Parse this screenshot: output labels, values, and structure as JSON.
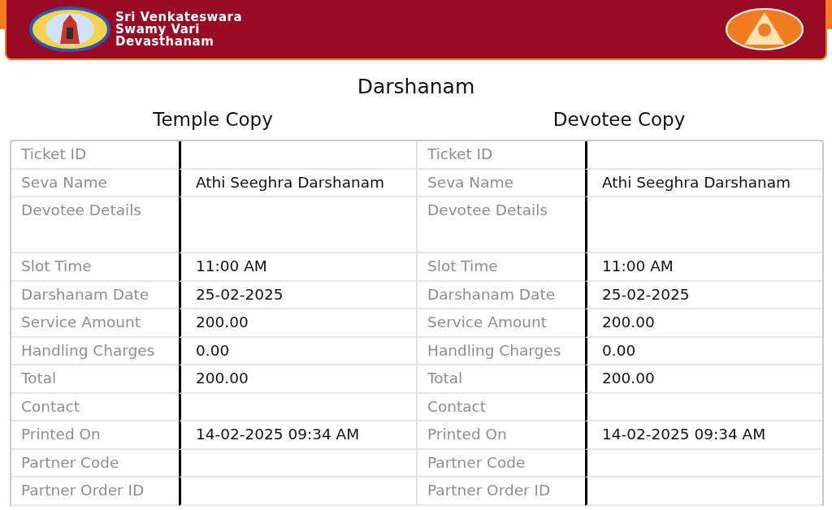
{
  "header": {
    "name_lines": [
      "Sri Venkateswara",
      "Swamy Vari",
      "Devasthanam"
    ]
  },
  "title": "Darshanam",
  "copies": [
    {
      "heading": "Temple Copy",
      "rows": [
        {
          "kind": "line",
          "label": "Ticket ID"
        },
        {
          "kind": "line",
          "label": "Seva Name",
          "value": "Athi Seeghra Darshanam"
        },
        {
          "kind": "tall",
          "label": "Devotee Details"
        },
        {
          "kind": "line",
          "label": "Slot Time",
          "value": "11:00 AM"
        },
        {
          "kind": "line",
          "label": "Darshanam Date",
          "value": "25-02-2025"
        },
        {
          "kind": "line",
          "label": "Service Amount",
          "value": "200.00"
        },
        {
          "kind": "line",
          "label": "Handling Charges",
          "value": "0.00"
        },
        {
          "kind": "line",
          "label": "Total",
          "value": "200.00"
        },
        {
          "kind": "line",
          "label": "Contact"
        },
        {
          "kind": "line",
          "label": "Printed On",
          "value": "14-02-2025 09:34 AM"
        },
        {
          "kind": "line",
          "label": "Partner Code"
        },
        {
          "kind": "line",
          "label": "Partner Order ID"
        }
      ]
    },
    {
      "heading": "Devotee Copy",
      "rows": [
        {
          "kind": "line",
          "label": "Ticket ID"
        },
        {
          "kind": "line",
          "label": "Seva Name",
          "value": "Athi Seeghra Darshanam"
        },
        {
          "kind": "tall",
          "label": "Devotee Details"
        },
        {
          "kind": "line",
          "label": "Slot Time",
          "value": "11:00 AM"
        },
        {
          "kind": "line",
          "label": "Darshanam Date",
          "value": "25-02-2025"
        },
        {
          "kind": "line",
          "label": "Service Amount",
          "value": "200.00"
        },
        {
          "kind": "line",
          "label": "Handling Charges",
          "value": "0.00"
        },
        {
          "kind": "line",
          "label": "Total",
          "value": "200.00"
        },
        {
          "kind": "line",
          "label": "Contact"
        },
        {
          "kind": "line",
          "label": "Printed On",
          "value": "14-02-2025 09:34 AM"
        },
        {
          "kind": "line",
          "label": "Partner Code"
        },
        {
          "kind": "line",
          "label": "Partner Order ID"
        }
      ]
    }
  ]
}
